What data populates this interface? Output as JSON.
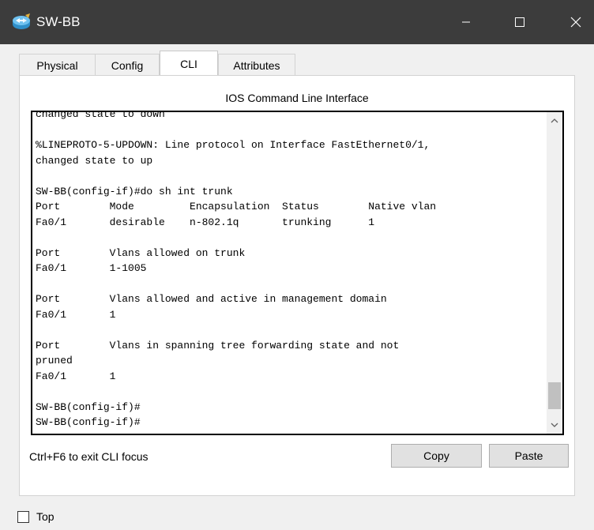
{
  "window": {
    "title": "SW-BB",
    "icon": "switch-app-icon",
    "controls": {
      "minimize": "minimize-icon",
      "maximize": "maximize-icon",
      "close": "close-icon"
    }
  },
  "tabs": [
    {
      "label": "Physical",
      "active": false
    },
    {
      "label": "Config",
      "active": false
    },
    {
      "label": "CLI",
      "active": true
    },
    {
      "label": "Attributes",
      "active": false
    }
  ],
  "cli": {
    "heading": "IOS Command Line Interface",
    "output": "changed state to down\n\n%LINEPROTO-5-UPDOWN: Line protocol on Interface FastEthernet0/1,\nchanged state to up\n\nSW-BB(config-if)#do sh int trunk\nPort        Mode         Encapsulation  Status        Native vlan\nFa0/1       desirable    n-802.1q       trunking      1\n\nPort        Vlans allowed on trunk\nFa0/1       1-1005\n\nPort        Vlans allowed and active in management domain\nFa0/1       1\n\nPort        Vlans in spanning tree forwarding state and not\npruned\nFa0/1       1\n\nSW-BB(config-if)#\nSW-BB(config-if)#",
    "focus_hint": "Ctrl+F6 to exit CLI focus",
    "copy_label": "Copy",
    "paste_label": "Paste"
  },
  "footer": {
    "top_checkbox_label": "Top",
    "top_checked": false
  },
  "colors": {
    "titlebar": "#3c3c3c",
    "window_bg": "#f0f0f0",
    "terminal_border": "#000000"
  }
}
